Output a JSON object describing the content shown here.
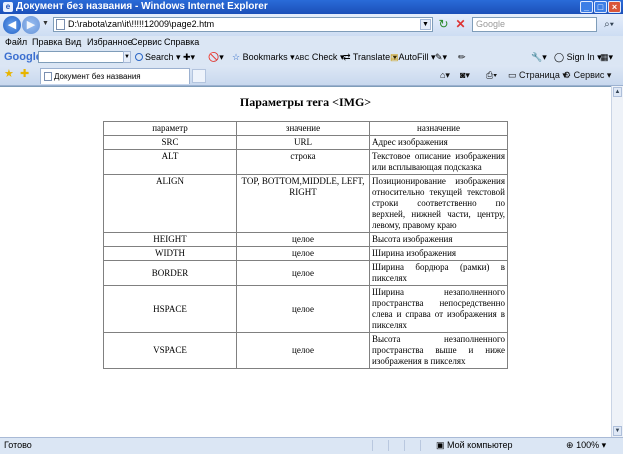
{
  "window": {
    "title": "Документ без названия - Windows Internet Explorer"
  },
  "navigation": {
    "address": "D:\\rabota\\zan\\it\\!!!!!12009\\page2.htm",
    "search_placeholder": "Google"
  },
  "menu": [
    "Файл",
    "Правка",
    "Вид",
    "Избранное",
    "Сервис",
    "Справка"
  ],
  "google_toolbar": {
    "logo": "Google",
    "search_label": "Search",
    "bookmarks_label": "Bookmarks",
    "check_label": "Check",
    "translate_label": "Translate",
    "autofill_label": "AutoFill",
    "signin_label": "Sign In"
  },
  "tab": {
    "title": "Документ без названия"
  },
  "command_bar": {
    "page_label": "Страница",
    "tools_label": "Сервис"
  },
  "document": {
    "heading": "Параметры тега <IMG>",
    "table": {
      "headers": [
        "параметр",
        "значение",
        "назначение"
      ],
      "rows": [
        {
          "param": "SRC",
          "value": "URL",
          "purpose": "Адрес изображения"
        },
        {
          "param": "ALT",
          "value": "строка",
          "purpose": "Текстовое описание изображения или всплывающая подсказка"
        },
        {
          "param": "ALIGN",
          "value": "TOP, BOTTOM,MIDDLE, LEFT, RIGHT",
          "purpose": "Позиционирование изображения относительно текущей текстовой строки соответственно по верхней, нижней части, центру, левому, правому краю"
        },
        {
          "param": "HEIGHT",
          "value": "целое",
          "purpose": "Высота изображения"
        },
        {
          "param": "WIDTH",
          "value": "целое",
          "purpose": "Ширина изображения"
        },
        {
          "param": "BORDER",
          "value": "целое",
          "purpose": "Ширина бордюра (рамки) в пикселях"
        },
        {
          "param": "HSPACE",
          "value": "целое",
          "purpose": "Ширина незаполненного пространства непосредственно слева и справа от изображения в пикселях"
        },
        {
          "param": "VSPACE",
          "value": "целое",
          "purpose": "Высота незаполненного пространства выше и ниже изображения в пикселях"
        }
      ]
    }
  },
  "status": {
    "text": "Готово",
    "zone": "Мой компьютер",
    "zoom": "100%"
  },
  "colors": {
    "titlebar": "#1b4fb8",
    "chrome": "#dbe6f4",
    "content_bg": "#ffffff"
  }
}
